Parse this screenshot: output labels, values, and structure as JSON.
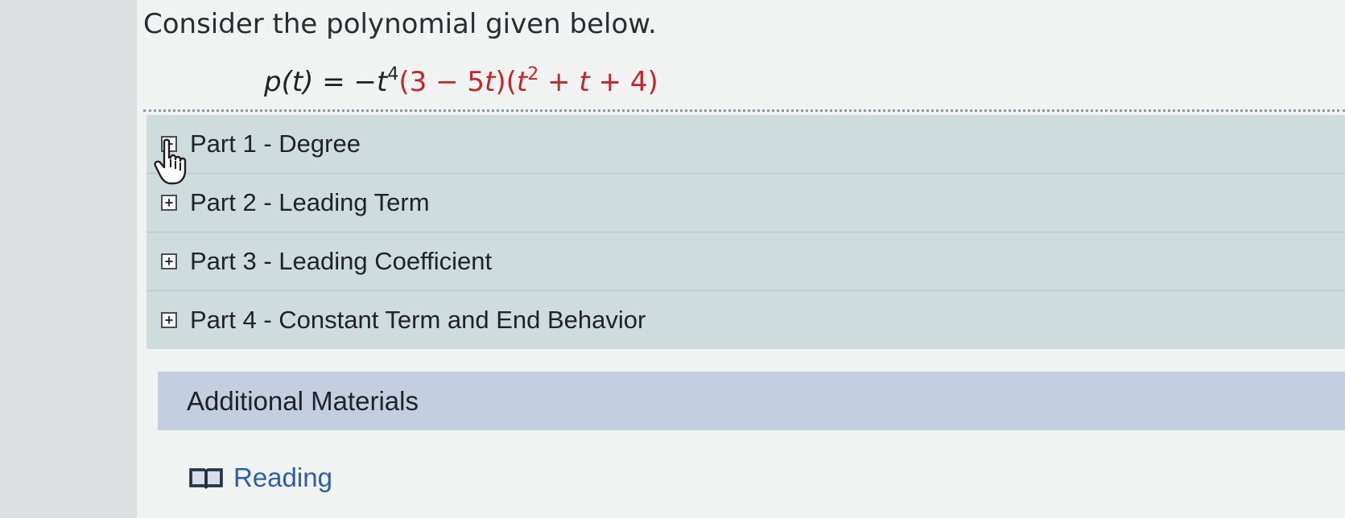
{
  "question": {
    "prompt": "Consider the polynomial given below.",
    "equation": {
      "lhs": "p(t) = −t",
      "lhs_exp": "4",
      "factor1_open": "(",
      "factor1_num": "3",
      "factor1_minus": " − 5",
      "factor1_var": "t",
      "factor1_close": ")",
      "factor2_open": "(",
      "factor2_var": "t",
      "factor2_exp": "2",
      "factor2_rest_plus1": " + ",
      "factor2_t": "t",
      "factor2_rest_plus2": " + 4",
      "factor2_close": ")"
    }
  },
  "parts": [
    {
      "toggle": "+",
      "label": "Part 1 - Degree"
    },
    {
      "toggle": "+",
      "label": "Part 2 - Leading Term"
    },
    {
      "toggle": "+",
      "label": "Part 3 - Leading Coefficient"
    },
    {
      "toggle": "+",
      "label": "Part 4 - Constant Term and End Behavior"
    }
  ],
  "materials": {
    "title": "Additional Materials",
    "links": [
      {
        "label": "Reading",
        "icon": "book-icon"
      }
    ]
  },
  "colors": {
    "accent_red": "#c0262a",
    "parts_bg": "#cfdcdd",
    "materials_header_bg": "#c3cfe0",
    "link_blue": "#2b5fa8"
  }
}
